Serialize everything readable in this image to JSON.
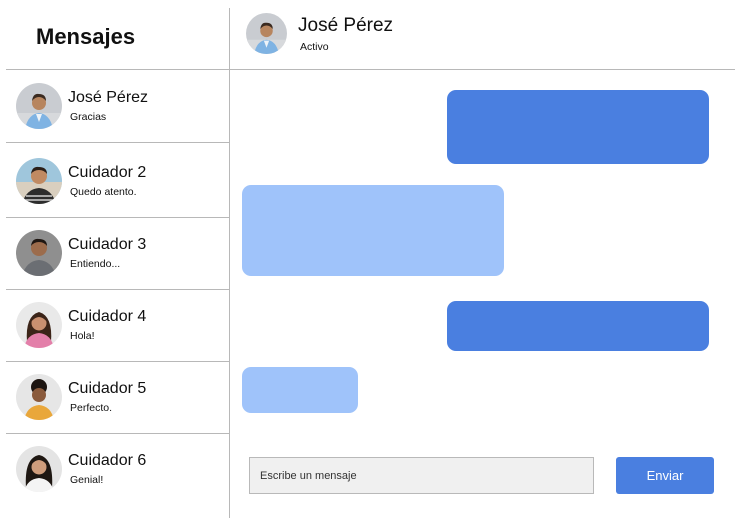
{
  "sidebar": {
    "title": "Mensajes",
    "contacts": [
      {
        "name": "José Pérez",
        "preview": "Gracias",
        "avatar": "avatar-jose-perez"
      },
      {
        "name": "Cuidador 2",
        "preview": "Quedo atento.",
        "avatar": "avatar-cuidador-2"
      },
      {
        "name": "Cuidador 3",
        "preview": "Entiendo...",
        "avatar": "avatar-cuidador-3"
      },
      {
        "name": "Cuidador 4",
        "preview": "Hola!",
        "avatar": "avatar-cuidador-4"
      },
      {
        "name": "Cuidador 5",
        "preview": "Perfecto.",
        "avatar": "avatar-cuidador-5"
      },
      {
        "name": "Cuidador 6",
        "preview": "Genial!",
        "avatar": "avatar-cuidador-6"
      }
    ]
  },
  "chat": {
    "name": "José Pérez",
    "status": "Activo",
    "messages": [
      {
        "direction": "outgoing"
      },
      {
        "direction": "incoming"
      },
      {
        "direction": "outgoing"
      },
      {
        "direction": "incoming"
      }
    ],
    "input_placeholder": "Escribe un mensaje",
    "send_label": "Enviar"
  },
  "colors": {
    "outgoing_bubble": "#4a7fe0",
    "incoming_bubble": "#9fc3fa",
    "send_button": "#4a7fe0",
    "divider": "#b8b8b8"
  }
}
